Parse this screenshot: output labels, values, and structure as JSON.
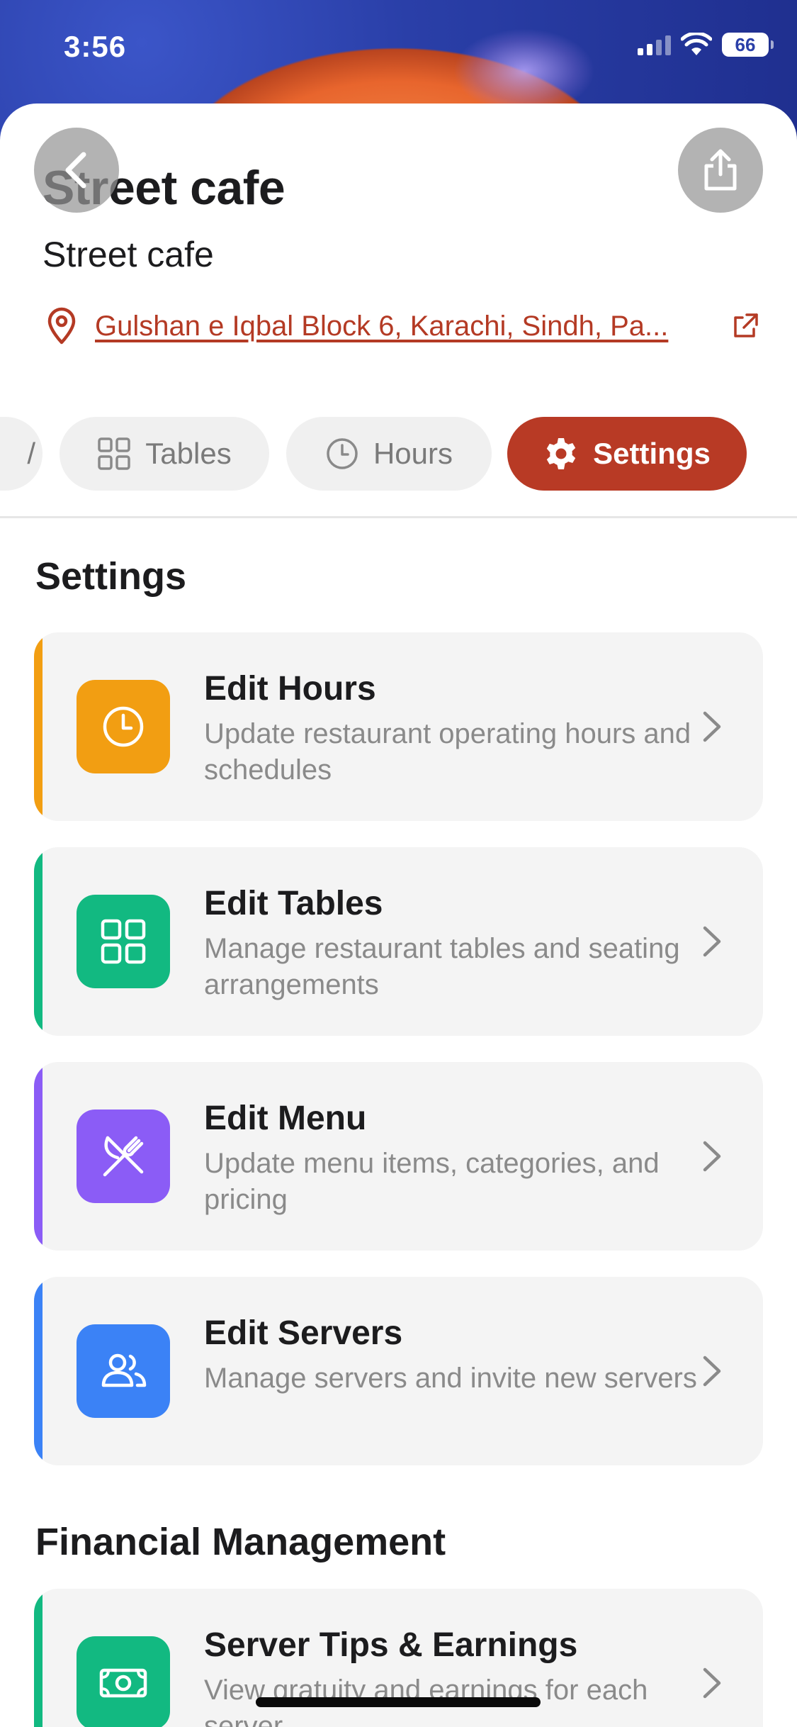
{
  "status_bar": {
    "time": "3:56",
    "battery": "66"
  },
  "header": {
    "title": "Street cafe",
    "subtitle": "Street cafe",
    "address": "Gulshan e Iqbal Block 6, Karachi, Sindh, Pa...",
    "accent_color": "#b83a25"
  },
  "tabs": [
    {
      "label": "",
      "icon": "partial-tab",
      "active": false
    },
    {
      "label": "Tables",
      "icon": "grid-icon",
      "active": false
    },
    {
      "label": "Hours",
      "icon": "clock-icon",
      "active": false
    },
    {
      "label": "Settings",
      "icon": "gear-icon",
      "active": true
    }
  ],
  "settings_section": {
    "title": "Settings",
    "items": [
      {
        "title": "Edit Hours",
        "description": "Update restaurant operating hours and schedules",
        "icon": "clock-icon",
        "color": "#f29e12"
      },
      {
        "title": "Edit Tables",
        "description": "Manage restaurant tables and seating arrangements",
        "icon": "grid-icon",
        "color": "#12b981"
      },
      {
        "title": "Edit Menu",
        "description": "Update menu items, categories, and pricing",
        "icon": "utensils-icon",
        "color": "#8b5cf6"
      },
      {
        "title": "Edit Servers",
        "description": "Manage servers and invite new servers",
        "icon": "users-icon",
        "color": "#3b82f6"
      }
    ]
  },
  "financial_section": {
    "title": "Financial Management",
    "items": [
      {
        "title": "Server Tips & Earnings",
        "description": "View gratuity and earnings for each server",
        "icon": "banknote-icon",
        "color": "#12b981"
      }
    ]
  }
}
